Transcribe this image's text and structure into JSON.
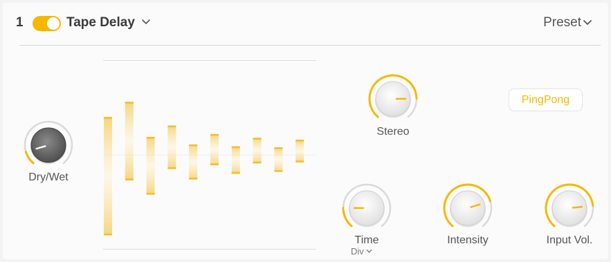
{
  "header": {
    "slot_number": "1",
    "effect_name": "Tape Delay",
    "enabled": true,
    "preset_label": "Preset"
  },
  "accent_color": "#f5b800",
  "knobs": {
    "dry_wet": {
      "label": "Dry/Wet",
      "value": 0.12
    },
    "stereo": {
      "label": "Stereo",
      "value": 0.82
    },
    "time": {
      "label": "Time",
      "value": 0.18,
      "sub_label": "Div"
    },
    "intensity": {
      "label": "Intensity",
      "value": 0.76
    },
    "input_vol": {
      "label": "Input Vol.",
      "value": 0.8
    }
  },
  "pingpong_label": "PingPong",
  "delay_taps": [
    {
      "up": 0.4,
      "down": 0.85
    },
    {
      "up": 0.56,
      "down": 0.27
    },
    {
      "up": 0.19,
      "down": 0.42
    },
    {
      "up": 0.31,
      "down": 0.15
    },
    {
      "up": 0.11,
      "down": 0.26
    },
    {
      "up": 0.22,
      "down": 0.11
    },
    {
      "up": 0.09,
      "down": 0.2
    },
    {
      "up": 0.18,
      "down": 0.09
    },
    {
      "up": 0.08,
      "down": 0.18
    },
    {
      "up": 0.16,
      "down": 0.08
    }
  ]
}
